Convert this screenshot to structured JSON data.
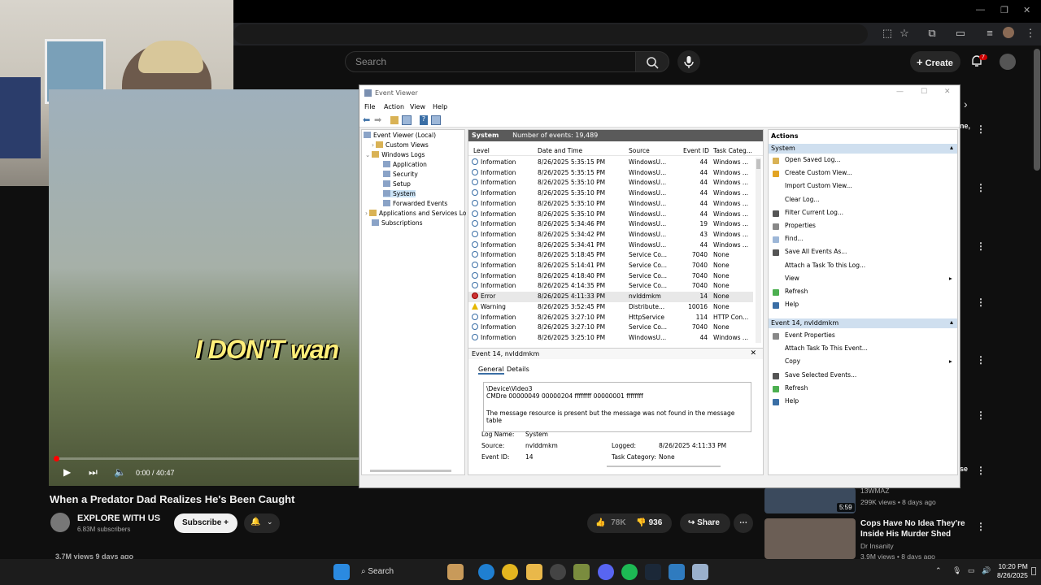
{
  "youtube": {
    "search_placeholder": "Search",
    "create_label": "Create",
    "notification_count": "7",
    "video": {
      "caption_text": "I DON'T wan",
      "time": "0:00 / 40:47",
      "title": "When a Predator Dad Realizes He's Been Caught",
      "channel": "EXPLORE WITH US",
      "subscribers": "6.83M subscribers",
      "subscribe_label": "Subscribe",
      "likes": "78K",
      "dislikes": "936",
      "share_label": "Share",
      "views": "3.7M views  9 days ago"
    },
    "recommendations": [
      {
        "channel": "13WMAZ",
        "meta": "299K views • 8 days ago",
        "duration": "5:59"
      },
      {
        "title_line1": "Cops Have No Idea They're",
        "title_line2": "Inside His Murder Shed",
        "channel": "Dr Insanity",
        "meta": "3.9M views • 8 days ago"
      }
    ],
    "partial_right_texts": [
      "ne,",
      "se"
    ]
  },
  "event_viewer": {
    "window_title": "Event Viewer",
    "menu": [
      "File",
      "Action",
      "View",
      "Help"
    ],
    "tree": [
      {
        "label": "Event Viewer (Local)",
        "level": 0
      },
      {
        "label": "Custom Views",
        "level": 1
      },
      {
        "label": "Windows Logs",
        "level": 1
      },
      {
        "label": "Application",
        "level": 2
      },
      {
        "label": "Security",
        "level": 2
      },
      {
        "label": "Setup",
        "level": 2
      },
      {
        "label": "System",
        "level": 2
      },
      {
        "label": "Forwarded Events",
        "level": 2
      },
      {
        "label": "Applications and Services Lo",
        "level": 1
      },
      {
        "label": "Subscriptions",
        "level": 1
      }
    ],
    "list_title": "System",
    "event_count": "Number of events: 19,489",
    "columns": [
      "Level",
      "Date and Time",
      "Source",
      "Event ID",
      "Task Categ..."
    ],
    "rows": [
      {
        "level": "Information",
        "date": "8/26/2025 5:35:15 PM",
        "source": "WindowsU...",
        "id": "44",
        "cat": "Windows ..."
      },
      {
        "level": "Information",
        "date": "8/26/2025 5:35:15 PM",
        "source": "WindowsU...",
        "id": "44",
        "cat": "Windows ..."
      },
      {
        "level": "Information",
        "date": "8/26/2025 5:35:10 PM",
        "source": "WindowsU...",
        "id": "44",
        "cat": "Windows ..."
      },
      {
        "level": "Information",
        "date": "8/26/2025 5:35:10 PM",
        "source": "WindowsU...",
        "id": "44",
        "cat": "Windows ..."
      },
      {
        "level": "Information",
        "date": "8/26/2025 5:35:10 PM",
        "source": "WindowsU...",
        "id": "44",
        "cat": "Windows ..."
      },
      {
        "level": "Information",
        "date": "8/26/2025 5:35:10 PM",
        "source": "WindowsU...",
        "id": "44",
        "cat": "Windows ..."
      },
      {
        "level": "Information",
        "date": "8/26/2025 5:34:46 PM",
        "source": "WindowsU...",
        "id": "19",
        "cat": "Windows ..."
      },
      {
        "level": "Information",
        "date": "8/26/2025 5:34:42 PM",
        "source": "WindowsU...",
        "id": "43",
        "cat": "Windows ..."
      },
      {
        "level": "Information",
        "date": "8/26/2025 5:34:41 PM",
        "source": "WindowsU...",
        "id": "44",
        "cat": "Windows ..."
      },
      {
        "level": "Information",
        "date": "8/26/2025 5:18:45 PM",
        "source": "Service Co...",
        "id": "7040",
        "cat": "None"
      },
      {
        "level": "Information",
        "date": "8/26/2025 5:14:41 PM",
        "source": "Service Co...",
        "id": "7040",
        "cat": "None"
      },
      {
        "level": "Information",
        "date": "8/26/2025 4:18:40 PM",
        "source": "Service Co...",
        "id": "7040",
        "cat": "None"
      },
      {
        "level": "Information",
        "date": "8/26/2025 4:14:35 PM",
        "source": "Service Co...",
        "id": "7040",
        "cat": "None"
      },
      {
        "level": "Error",
        "date": "8/26/2025 4:11:33 PM",
        "source": "nvlddmkm",
        "id": "14",
        "cat": "None"
      },
      {
        "level": "Warning",
        "date": "8/26/2025 3:52:45 PM",
        "source": "Distribute...",
        "id": "10016",
        "cat": "None"
      },
      {
        "level": "Information",
        "date": "8/26/2025 3:27:10 PM",
        "source": "HttpService",
        "id": "114",
        "cat": "HTTP Con..."
      },
      {
        "level": "Information",
        "date": "8/26/2025 3:27:10 PM",
        "source": "Service Co...",
        "id": "7040",
        "cat": "None"
      },
      {
        "level": "Information",
        "date": "8/26/2025 3:25:10 PM",
        "source": "WindowsU...",
        "id": "44",
        "cat": "Windows ..."
      }
    ],
    "detail": {
      "title": "Event 14, nvlddmkm",
      "tabs": [
        "General",
        "Details"
      ],
      "line1": "\\Device\\Video3",
      "line2": "CMDre 00000049 00000204 ffffffff 00000001 ffffffff",
      "line3": "The message resource is present but the message was not found in the message table",
      "log_name_label": "Log Name:",
      "log_name": "System",
      "source_label": "Source:",
      "source": "nvlddmkm",
      "logged_label": "Logged:",
      "logged": "8/26/2025 4:11:33 PM",
      "event_id_label": "Event ID:",
      "event_id": "14",
      "task_cat_label": "Task Category:",
      "task_cat": "None"
    },
    "actions": {
      "header": "Actions",
      "section1": "System",
      "items1": [
        "Open Saved Log...",
        "Create Custom View...",
        "Import Custom View...",
        "Clear Log...",
        "Filter Current Log...",
        "Properties",
        "Find...",
        "Save All Events As...",
        "Attach a Task To this Log...",
        "View",
        "Refresh",
        "Help"
      ],
      "section2": "Event 14, nvlddmkm",
      "items2": [
        "Event Properties",
        "Attach Task To This Event...",
        "Copy",
        "Save Selected Events...",
        "Refresh",
        "Help"
      ]
    }
  },
  "taskbar": {
    "search_label": "Search",
    "time": "10:20 PM",
    "date": "8/26/2025"
  }
}
